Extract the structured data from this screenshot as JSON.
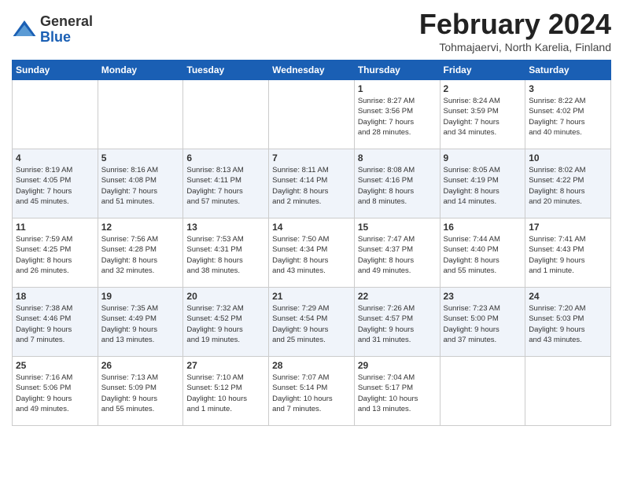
{
  "header": {
    "logo_general": "General",
    "logo_blue": "Blue",
    "month_title": "February 2024",
    "subtitle": "Tohmajaervi, North Karelia, Finland"
  },
  "days_of_week": [
    "Sunday",
    "Monday",
    "Tuesday",
    "Wednesday",
    "Thursday",
    "Friday",
    "Saturday"
  ],
  "weeks": [
    [
      {
        "day": "",
        "info": ""
      },
      {
        "day": "",
        "info": ""
      },
      {
        "day": "",
        "info": ""
      },
      {
        "day": "",
        "info": ""
      },
      {
        "day": "1",
        "info": "Sunrise: 8:27 AM\nSunset: 3:56 PM\nDaylight: 7 hours\nand 28 minutes."
      },
      {
        "day": "2",
        "info": "Sunrise: 8:24 AM\nSunset: 3:59 PM\nDaylight: 7 hours\nand 34 minutes."
      },
      {
        "day": "3",
        "info": "Sunrise: 8:22 AM\nSunset: 4:02 PM\nDaylight: 7 hours\nand 40 minutes."
      }
    ],
    [
      {
        "day": "4",
        "info": "Sunrise: 8:19 AM\nSunset: 4:05 PM\nDaylight: 7 hours\nand 45 minutes."
      },
      {
        "day": "5",
        "info": "Sunrise: 8:16 AM\nSunset: 4:08 PM\nDaylight: 7 hours\nand 51 minutes."
      },
      {
        "day": "6",
        "info": "Sunrise: 8:13 AM\nSunset: 4:11 PM\nDaylight: 7 hours\nand 57 minutes."
      },
      {
        "day": "7",
        "info": "Sunrise: 8:11 AM\nSunset: 4:14 PM\nDaylight: 8 hours\nand 2 minutes."
      },
      {
        "day": "8",
        "info": "Sunrise: 8:08 AM\nSunset: 4:16 PM\nDaylight: 8 hours\nand 8 minutes."
      },
      {
        "day": "9",
        "info": "Sunrise: 8:05 AM\nSunset: 4:19 PM\nDaylight: 8 hours\nand 14 minutes."
      },
      {
        "day": "10",
        "info": "Sunrise: 8:02 AM\nSunset: 4:22 PM\nDaylight: 8 hours\nand 20 minutes."
      }
    ],
    [
      {
        "day": "11",
        "info": "Sunrise: 7:59 AM\nSunset: 4:25 PM\nDaylight: 8 hours\nand 26 minutes."
      },
      {
        "day": "12",
        "info": "Sunrise: 7:56 AM\nSunset: 4:28 PM\nDaylight: 8 hours\nand 32 minutes."
      },
      {
        "day": "13",
        "info": "Sunrise: 7:53 AM\nSunset: 4:31 PM\nDaylight: 8 hours\nand 38 minutes."
      },
      {
        "day": "14",
        "info": "Sunrise: 7:50 AM\nSunset: 4:34 PM\nDaylight: 8 hours\nand 43 minutes."
      },
      {
        "day": "15",
        "info": "Sunrise: 7:47 AM\nSunset: 4:37 PM\nDaylight: 8 hours\nand 49 minutes."
      },
      {
        "day": "16",
        "info": "Sunrise: 7:44 AM\nSunset: 4:40 PM\nDaylight: 8 hours\nand 55 minutes."
      },
      {
        "day": "17",
        "info": "Sunrise: 7:41 AM\nSunset: 4:43 PM\nDaylight: 9 hours\nand 1 minute."
      }
    ],
    [
      {
        "day": "18",
        "info": "Sunrise: 7:38 AM\nSunset: 4:46 PM\nDaylight: 9 hours\nand 7 minutes."
      },
      {
        "day": "19",
        "info": "Sunrise: 7:35 AM\nSunset: 4:49 PM\nDaylight: 9 hours\nand 13 minutes."
      },
      {
        "day": "20",
        "info": "Sunrise: 7:32 AM\nSunset: 4:52 PM\nDaylight: 9 hours\nand 19 minutes."
      },
      {
        "day": "21",
        "info": "Sunrise: 7:29 AM\nSunset: 4:54 PM\nDaylight: 9 hours\nand 25 minutes."
      },
      {
        "day": "22",
        "info": "Sunrise: 7:26 AM\nSunset: 4:57 PM\nDaylight: 9 hours\nand 31 minutes."
      },
      {
        "day": "23",
        "info": "Sunrise: 7:23 AM\nSunset: 5:00 PM\nDaylight: 9 hours\nand 37 minutes."
      },
      {
        "day": "24",
        "info": "Sunrise: 7:20 AM\nSunset: 5:03 PM\nDaylight: 9 hours\nand 43 minutes."
      }
    ],
    [
      {
        "day": "25",
        "info": "Sunrise: 7:16 AM\nSunset: 5:06 PM\nDaylight: 9 hours\nand 49 minutes."
      },
      {
        "day": "26",
        "info": "Sunrise: 7:13 AM\nSunset: 5:09 PM\nDaylight: 9 hours\nand 55 minutes."
      },
      {
        "day": "27",
        "info": "Sunrise: 7:10 AM\nSunset: 5:12 PM\nDaylight: 10 hours\nand 1 minute."
      },
      {
        "day": "28",
        "info": "Sunrise: 7:07 AM\nSunset: 5:14 PM\nDaylight: 10 hours\nand 7 minutes."
      },
      {
        "day": "29",
        "info": "Sunrise: 7:04 AM\nSunset: 5:17 PM\nDaylight: 10 hours\nand 13 minutes."
      },
      {
        "day": "",
        "info": ""
      },
      {
        "day": "",
        "info": ""
      }
    ]
  ]
}
